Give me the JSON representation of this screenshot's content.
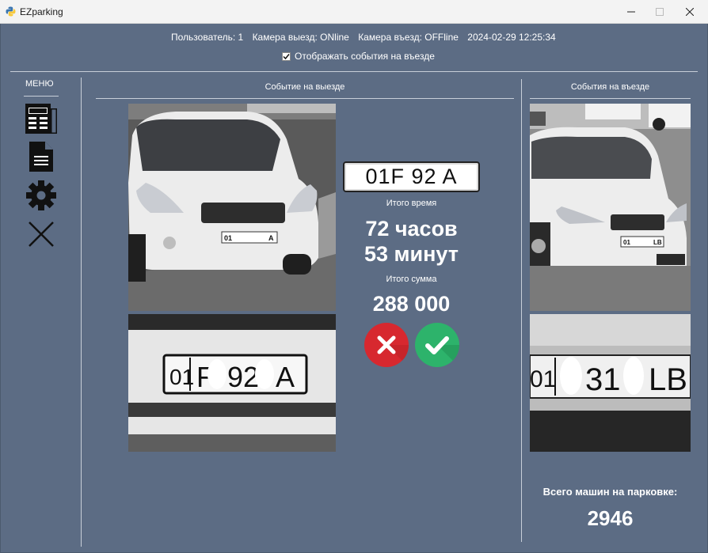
{
  "window": {
    "title": "EZparking"
  },
  "status": {
    "user": "Пользователь: 1",
    "exit_camera": "Камера выезд: ONline",
    "entry_camera": "Камера въезд: OFFline",
    "datetime": "2024-02-29 12:25:34"
  },
  "options": {
    "show_entry_events_label": "Отображать события на въезде",
    "show_entry_events_checked": true
  },
  "menu": {
    "label": "МЕНЮ",
    "items": [
      "newspaper-icon",
      "document-icon",
      "gear-icon",
      "close-icon"
    ]
  },
  "exit_event": {
    "title": "Событие на выезде",
    "car_plate_photo_text": "01 A",
    "plate_closeup_parts": [
      "01",
      "F",
      "92",
      "A"
    ],
    "plate_number": "01F  92  A",
    "total_time_label": "Итого время",
    "hours": "72 часов",
    "minutes": "53 минут",
    "total_sum_label": "Итого сумма",
    "sum": "288 000"
  },
  "entry_event": {
    "title": "События на въезде",
    "car_plate_photo_text": "01 LB",
    "plate_closeup_parts": [
      "01",
      "31",
      "LB"
    ]
  },
  "summary": {
    "label": "Всего машин на парковке:",
    "count": "2946"
  },
  "colors": {
    "background": "#5c6c84",
    "reject": "#d7282f",
    "accept": "#2db36b"
  }
}
